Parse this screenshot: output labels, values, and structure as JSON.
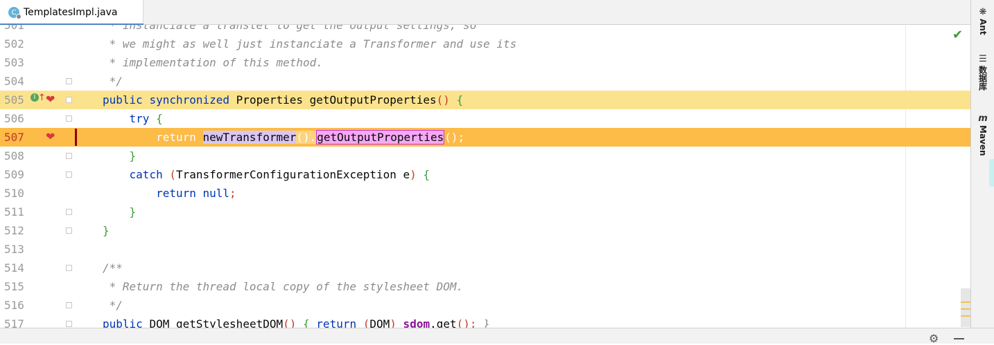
{
  "tab": {
    "filename": "TemplatesImpl.java",
    "icon_letter": "C"
  },
  "editor": {
    "lines": [
      {
        "num": "501",
        "kind": "comment",
        "text": " * instanciate a translet to get the output settings, so"
      },
      {
        "num": "502",
        "kind": "comment",
        "text": " * we might as well just instanciate a Transformer and use its"
      },
      {
        "num": "503",
        "kind": "comment",
        "text": " * implementation of this method."
      },
      {
        "num": "504",
        "kind": "comment",
        "text": " */"
      },
      {
        "num": "505",
        "kind": "method"
      },
      {
        "num": "506",
        "kind": "try"
      },
      {
        "num": "507",
        "kind": "return-call"
      },
      {
        "num": "508",
        "kind": "brace-g-inner"
      },
      {
        "num": "509",
        "kind": "catch"
      },
      {
        "num": "510",
        "kind": "return-null"
      },
      {
        "num": "511",
        "kind": "brace-g-inner"
      },
      {
        "num": "512",
        "kind": "brace-g-outer"
      },
      {
        "num": "513",
        "kind": "blank"
      },
      {
        "num": "514",
        "kind": "comment",
        "text": "/**"
      },
      {
        "num": "515",
        "kind": "comment",
        "text": " * Return the thread local copy of the stylesheet DOM."
      },
      {
        "num": "516",
        "kind": "comment",
        "text": " */"
      },
      {
        "num": "517",
        "kind": "getdom"
      }
    ],
    "tokens": {
      "public": "public",
      "synchronized": "synchronized",
      "properties_type": "Properties",
      "get_output_properties": "getOutputProperties",
      "paren_pair": "()",
      "open_brace": "{",
      "close_brace": "}",
      "try": "try",
      "return": "return",
      "new_transformer": "newTransformer",
      "dot_sep": "().",
      "semicolon_tail": "();",
      "catch": "catch",
      "open_paren": "(",
      "close_paren": ")",
      "tce_param": "TransformerConfigurationException e",
      "null_value": "null",
      "semicolon": ";",
      "dom_type": "DOM",
      "get_stylesheet_dom": "getStylesheetDOM",
      "cast_dom": "DOM",
      "sdom_field": "_sdom",
      "dot_get": ".get",
      "close_paren_semi": "();",
      "close_brace_italic": "}"
    }
  },
  "right_stripe": {
    "items": [
      {
        "label": "Ant",
        "icon": "ant-icon"
      },
      {
        "label": "数据库",
        "icon": "database-icon"
      },
      {
        "label": "Maven",
        "icon": "maven-icon"
      }
    ]
  },
  "gutter": {
    "override_marker": "I",
    "override_arrow": "↑"
  },
  "colors": {
    "method_highlight": "#fbe38e",
    "current_line_highlight": "#fdbb47",
    "keyword": "#0033b3",
    "comment": "#8c8c8c",
    "field": "#871094"
  }
}
